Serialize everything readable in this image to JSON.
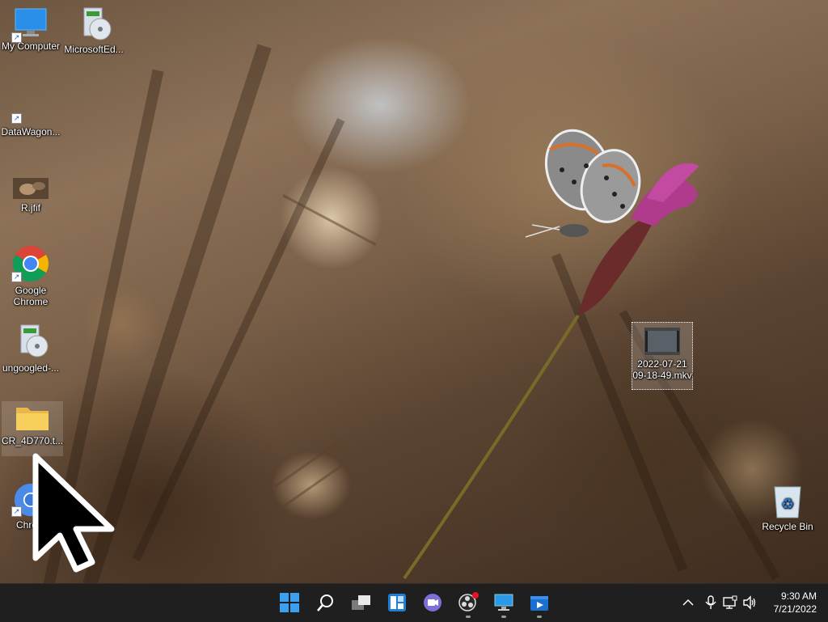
{
  "desktop": {
    "icons": {
      "my_computer": "My Computer",
      "microsoft_edge": "MicrosoftEd...",
      "datawagon": "DataWagon...",
      "rjfif": "R.jfif",
      "google_chrome": "Google Chrome",
      "ungoogled": "ungoogled-...",
      "cr_folder": "CR_4D770.t...",
      "chromium": "Chrom",
      "mkv_line1": "2022-07-21",
      "mkv_line2": "09-18-49.mkv",
      "recycle_bin": "Recycle Bin"
    }
  },
  "taskbar": {
    "apps": [
      "start-icon",
      "search-icon",
      "task-view-icon",
      "widgets-icon",
      "teams-chat-icon",
      "obs-icon",
      "remote-desktop-icon",
      "media-player-icon"
    ],
    "tray": [
      "chevron-up-icon",
      "microphone-icon",
      "network-icon",
      "volume-icon"
    ],
    "time": "9:30 AM",
    "date": "7/21/2022"
  },
  "colors": {
    "taskbar_bg": "#1f1f1f",
    "windows_blue": "#3aa0f0",
    "notification_red": "#e81123"
  }
}
